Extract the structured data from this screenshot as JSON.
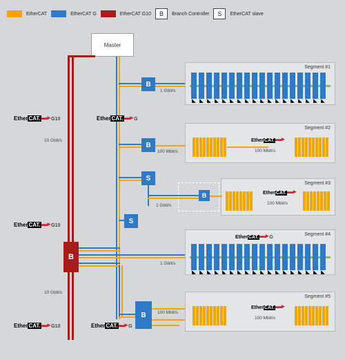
{
  "legend": {
    "ethercat": "EtherCAT",
    "ethercat_g": "EtherCAT G",
    "ethercat_g10": "EtherCAT G10",
    "branch": "Branch Controller",
    "slave": "EtherCAT slave",
    "b": "B",
    "s": "S"
  },
  "colors": {
    "ethercat": "#f5a500",
    "ethercat_g": "#2e7ac7",
    "ethercat_g10": "#a81b1b"
  },
  "master": "Master",
  "segments": {
    "s1": "Segment #1",
    "s2": "Segment #2",
    "s3": "Segment #3",
    "s4": "Segment #4",
    "s5": "Segment #5"
  },
  "speeds": {
    "g1": "1 Gbit/s",
    "m100": "100 Mbit/s",
    "g10": "10 Gbit/s"
  },
  "logo": {
    "ether": "Ether",
    "cat": "CAT.",
    "g": "G",
    "g10": "G10"
  },
  "letters": {
    "B": "B",
    "S": "S"
  }
}
